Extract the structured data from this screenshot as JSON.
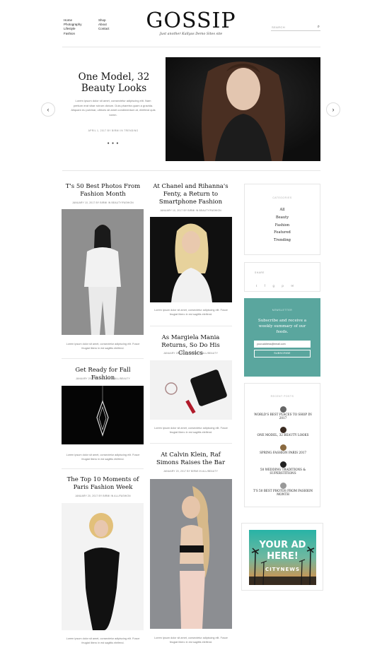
{
  "header": {
    "nav_left": [
      "Home",
      "Photography",
      "Lifestyle",
      "Fashion"
    ],
    "nav_right": [
      "Shop",
      "About",
      "Contact"
    ],
    "logo": "GOSSIP",
    "tagline": "Just another Kallyas Demo Sites site",
    "search_placeholder": "SEARCH"
  },
  "slider": {
    "title": "One Model, 32 Beauty Looks",
    "excerpt": "Lorem ipsum dolor sit amet, consectetur adipiscing elit. Nam pretium erat vitae rutrum dictum. Duis pharetra quam a gravida. Aliquam eu pulvinar, ultrices sit amet condimentum at, eleifend quis lorem.",
    "meta": "APRIL 1, 2017 BY BIRMI IN TRENDING",
    "dots": "● ● ●"
  },
  "posts": {
    "p1": {
      "title": "T's 50 Best Photos From Fashion Month",
      "meta": "JANUARY 10, 2017 BY BIRMI IN BEAUTY/FASHION",
      "excerpt": "Lorem ipsum dolor sit amet, consectetur adipiscing elit. Fusce feugiat libero in est sagittis eleifend."
    },
    "p2": {
      "title": "At Chanel and Rihanna's Fenty, a Return to Smartphone Fashion",
      "meta": "JANUARY 10, 2017 BY BIRMI IN BEAUTY/FASHION",
      "excerpt": "Lorem ipsum dolor sit amet, consectetur adipiscing elit. Fusce feugiat libero in est sagittis eleifend."
    },
    "p3": {
      "title": "Get Ready for Fall Fashion",
      "meta": "JANUARY 20, 2017 BY BIRMI IN ALL/BEAUTY",
      "excerpt": "Lorem ipsum dolor sit amet, consectetur adipiscing elit. Fusce feugiat libero in est sagittis eleifend."
    },
    "p4": {
      "title": "As Margiela Mania Returns, So Do His Classics",
      "meta": "JANUARY 20, 2017 BY BIRMI IN ALL/BEAUTY",
      "excerpt": "Lorem ipsum dolor sit amet, consectetur adipiscing elit. Fusce feugiat libero in est sagittis eleifend."
    },
    "p5": {
      "title": "The Top 10 Moments of Paris Fashion Week",
      "meta": "JANUARY 20, 2017 BY BIRMI IN ALL/FASHION",
      "excerpt": "Lorem ipsum dolor sit amet, consectetur adipiscing elit. Fusce feugiat libero in est sagittis eleifend."
    },
    "p6": {
      "title": "At Calvin Klein, Raf Simons Raises the Bar",
      "meta": "JANUARY 20, 2017 BY BIRMI IN ALL/BEAUTY",
      "excerpt": "Lorem ipsum dolor sit amet, consectetur adipiscing elit. Fusce feugiat libero in est sagittis eleifend."
    }
  },
  "sidebar": {
    "categories_heading": "CATEGORIES",
    "categories": [
      "All",
      "Beauty",
      "Fashion",
      "Featured",
      "Trending"
    ],
    "share_heading": "SHARE",
    "share_icons": [
      "twitter-icon",
      "facebook-icon",
      "google-icon",
      "pinterest-icon",
      "mail-icon"
    ],
    "share_glyphs": [
      "t",
      "f",
      "g",
      "p",
      "✉"
    ],
    "newsletter_heading": "NEWSLETTER",
    "newsletter_title": "Subscribe and receive a weekly summary of our feeds.",
    "newsletter_placeholder": "your.address@email.com",
    "newsletter_button": "SUBSCRIBE",
    "recent_heading": "RECENT POSTS",
    "recent": [
      "WORLD'S BEST PLACES TO SHOP IN 2017",
      "ONE MODEL, 32 BEAUTY LOOKS",
      "SPRING FASHION PARIS 2017",
      "50 WEDDING TRADITIONS & SUPERSTITIONS",
      "T'S 50 BEST PHOTOS FROM FASHION MONTH"
    ],
    "ad": {
      "line1": "YOUR AD",
      "line2": "HERE!",
      "brand": "CITYNEWS"
    }
  },
  "colors": {
    "accent": "#5aa69e"
  }
}
